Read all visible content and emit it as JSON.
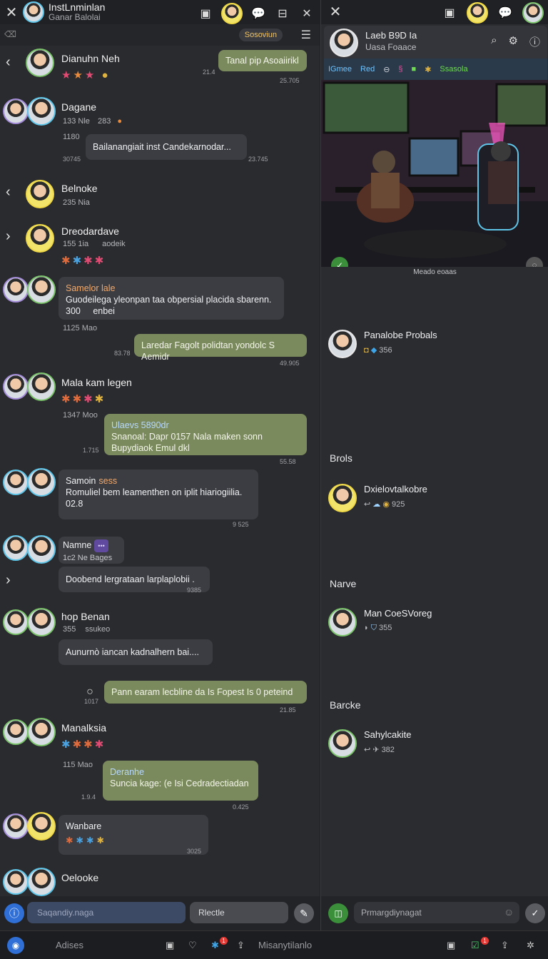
{
  "left": {
    "title": "InstLnminlan",
    "subtitle": "Ganar Balolai",
    "badge": "Sosoviun",
    "messages": [
      {
        "name": "Dianuhn Neh",
        "meta": "",
        "emoji": "★★★ 🍔",
        "bubble": "",
        "time": "21.4"
      },
      {
        "name": "Dagane",
        "meta": "133 Nle",
        "meta_count": "283",
        "time": "1180",
        "bubble": "Bailanangiait inst Candekarnodar...",
        "stamp": "23.745",
        "left_stamp": "30745"
      },
      {
        "name": "Belnoke",
        "meta": "235 Nia"
      },
      {
        "name": "Dreodardave",
        "meta": "155 1ia",
        "meta_extra": "aodeik"
      },
      {
        "name": "Samelor lale",
        "bubble": "Guodeilega yleonpan taa obpersial placida sbarenn.",
        "counts": "300",
        "counts2": "enbei",
        "time": "1125 Mao"
      },
      {
        "name": "Mala kam legen",
        "time": "1347 Moo"
      },
      {
        "name": "Samoin",
        "name_tag": "sess",
        "bubble": "Romuliel bem leamenthen on iplit hiariogiilia.",
        "counts": "02.8",
        "stamp": "9 525"
      },
      {
        "name": "Namne",
        "meta": "1c2 Ne Bages",
        "bubble": "Doobend lergrataan larplaplobii .",
        "stamp": "9385"
      },
      {
        "name": "hop Benan",
        "meta": "355",
        "meta_extra": "ssukeo",
        "bubble": "Aunurnò iancan kadnalhern bai...."
      },
      {
        "name": "Manalksia",
        "time": "115 Mao"
      },
      {
        "name": "Wanbare",
        "stamp": "3025"
      },
      {
        "name": "Oelooke"
      }
    ],
    "right_bubble_1": "Tanal pip Asoaiirikl",
    "right_stamp_1": "25.705",
    "right_bubble_2": "Laredar Fagolt polidtan yondolc S Aemidr",
    "right_stamp_2": "49.905",
    "right_time_2": "83.78",
    "right_bubble_3_head": "Ulaevs 5890dr",
    "right_bubble_3": "Snanoal: Dapr 0157 Nala maken sonn Bupydiaok Emul dkl",
    "right_stamp_3": "55.58",
    "right_time_3": "1.715",
    "right_bubble_4": "Pann earam lecbline da Is Fopest Is 0 peteind",
    "right_stamp_4": "21.85",
    "right_time_4": "1017",
    "right_bubble_5_head": "Deranhe",
    "right_bubble_5": "Suncia kage: (e Isi Cedradectiadan",
    "right_stamp_5": "0.425",
    "right_time_5": "1.9.4"
  },
  "composer_left": {
    "placeholder": "Saqandiy.naga",
    "button": "Rlectle"
  },
  "right": {
    "header_name": "Laeb B9D Ia",
    "header_sub": "Uasa Foaace",
    "tabs": [
      "IGmee",
      "Red",
      "Ssasola"
    ],
    "caption": "Meado eoaas",
    "items": [
      {
        "name": "Panalobe Probals",
        "meta": "356"
      },
      {
        "section": "Brols"
      },
      {
        "name": "Dxielovtalkobre",
        "meta": "925"
      },
      {
        "section": "Narve"
      },
      {
        "name": "Man CoeSVoreg",
        "meta": "355"
      },
      {
        "section": "Barcke"
      },
      {
        "name": "Sahylcakite",
        "meta": "382"
      }
    ],
    "composer_placeholder": "Prmargdiynagat"
  },
  "bottom": {
    "left_label": "Adises",
    "right_label": "Misanytilanlo"
  },
  "colors": {
    "green_bubble": "#7a8a5c",
    "gray_bubble": "#3c3d42",
    "accent": "#2f6fd6"
  }
}
